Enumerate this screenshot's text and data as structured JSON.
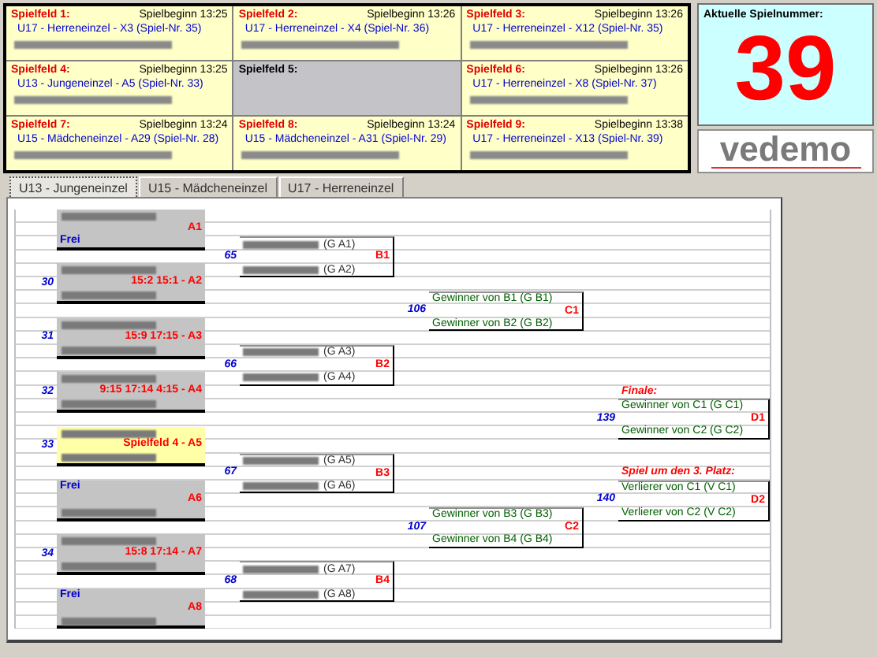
{
  "courts": [
    {
      "label": "Spielfeld 1:",
      "start": "Spielbeginn 13:25",
      "match": "U17 - Herreneinzel - X3   (Spiel-Nr. 35)",
      "active": true
    },
    {
      "label": "Spielfeld 2:",
      "start": "Spielbeginn 13:26",
      "match": "U17 - Herreneinzel - X4   (Spiel-Nr. 36)",
      "active": true
    },
    {
      "label": "Spielfeld 3:",
      "start": "Spielbeginn 13:26",
      "match": "U17 - Herreneinzel - X12   (Spiel-Nr. 35)",
      "active": true
    },
    {
      "label": "Spielfeld 4:",
      "start": "Spielbeginn 13:25",
      "match": "U13 - Jungeneinzel - A5   (Spiel-Nr. 33)",
      "active": true
    },
    {
      "label": "Spielfeld 5:",
      "active": false
    },
    {
      "label": "Spielfeld 6:",
      "start": "Spielbeginn 13:26",
      "match": "U17 - Herreneinzel - X8   (Spiel-Nr. 37)",
      "active": true
    },
    {
      "label": "Spielfeld 7:",
      "start": "Spielbeginn 13:24",
      "match": "U15 - Mädcheneinzel - A29   (Spiel-Nr. 28)",
      "active": true
    },
    {
      "label": "Spielfeld 8:",
      "start": "Spielbeginn 13:24",
      "match": "U15 - Mädcheneinzel - A31   (Spiel-Nr. 29)",
      "active": true
    },
    {
      "label": "Spielfeld 9:",
      "start": "Spielbeginn 13:38",
      "match": "U17 - Herreneinzel - X13   (Spiel-Nr. 39)",
      "active": true
    }
  ],
  "current_match": {
    "label": "Aktuelle Spielnummer:",
    "number": "39"
  },
  "logo": {
    "text": "vedemo"
  },
  "tabs": [
    {
      "label": "U13 - Jungeneinzel",
      "selected": true
    },
    {
      "label": "U15 - Mädcheneinzel",
      "selected": false
    },
    {
      "label": "U17 - Herreneinzel",
      "selected": false
    }
  ],
  "round_a": [
    {
      "result": "A1",
      "current": false,
      "players": [
        {
          "kind": "hidden"
        },
        {
          "kind": "bye",
          "text": "Frei"
        }
      ]
    },
    {
      "number": "30",
      "result": "15:2   15:1  -  A2",
      "current": false,
      "players": [
        {
          "kind": "hidden"
        },
        {
          "kind": "hidden"
        }
      ]
    },
    {
      "number": "31",
      "result": "15:9   17:15  -  A3",
      "current": false,
      "players": [
        {
          "kind": "hidden"
        },
        {
          "kind": "hidden"
        }
      ]
    },
    {
      "number": "32",
      "result": "9:15   17:14   4:15  -  A4",
      "current": false,
      "players": [
        {
          "kind": "hidden"
        },
        {
          "kind": "hidden"
        }
      ]
    },
    {
      "number": "33",
      "result": "Spielfeld 4  -  A5",
      "current": true,
      "players": [
        {
          "kind": "hidden"
        },
        {
          "kind": "hidden"
        }
      ]
    },
    {
      "result": "A6",
      "current": false,
      "players": [
        {
          "kind": "bye",
          "text": "Frei"
        },
        {
          "kind": "hidden"
        }
      ]
    },
    {
      "number": "34",
      "result": "15:8   17:14  -  A7",
      "current": false,
      "players": [
        {
          "kind": "hidden"
        },
        {
          "kind": "hidden"
        }
      ]
    },
    {
      "result": "A8",
      "current": false,
      "players": [
        {
          "kind": "bye",
          "text": "Frei"
        },
        {
          "kind": "hidden"
        }
      ]
    }
  ],
  "round_b": [
    {
      "number": "65",
      "label": "B1",
      "entries": [
        "(G  A1)",
        "(G  A2)"
      ]
    },
    {
      "number": "66",
      "label": "B2",
      "entries": [
        "(G  A3)",
        "(G  A4)"
      ]
    },
    {
      "number": "67",
      "label": "B3",
      "entries": [
        "(G  A5)",
        "(G  A6)"
      ]
    },
    {
      "number": "68",
      "label": "B4",
      "entries": [
        "(G  A7)",
        "(G  A8)"
      ]
    }
  ],
  "round_c": [
    {
      "number": "106",
      "label": "C1",
      "entries": [
        "Gewinner von B1  (G  B1)",
        "Gewinner von B2  (G  B2)"
      ]
    },
    {
      "number": "107",
      "label": "C2",
      "entries": [
        "Gewinner von B3  (G  B3)",
        "Gewinner von B4  (G  B4)"
      ]
    }
  ],
  "finals": [
    {
      "heading": "Finale:",
      "number": "139",
      "label": "D1",
      "entries": [
        "Gewinner von C1  (G  C1)",
        "Gewinner von C2  (G  C2)"
      ]
    },
    {
      "heading": "Spiel um den 3. Platz:",
      "number": "140",
      "label": "D2",
      "entries": [
        "Verlierer von C1  (V C1)",
        "Verlierer von C2  (V C2)"
      ]
    }
  ]
}
